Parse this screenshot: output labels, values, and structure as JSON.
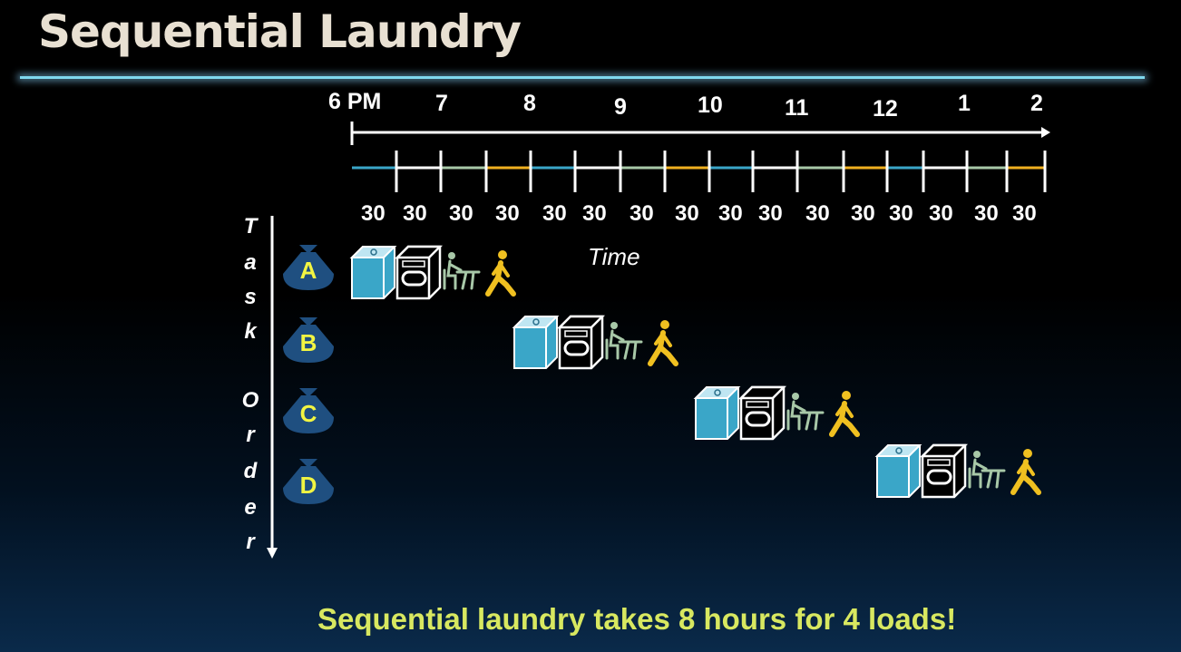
{
  "title": "Sequential Laundry",
  "timeline": {
    "hours": [
      "6 PM",
      "7",
      "8",
      "9",
      "10",
      "11",
      "12",
      "1",
      "2"
    ],
    "halves": [
      "30",
      "30",
      "30",
      "30",
      "30",
      "30",
      "30",
      "30",
      "30",
      "30",
      "30",
      "30",
      "30",
      "30",
      "30",
      "30"
    ],
    "segment_colors": [
      "#3aa6c8",
      "#ffffff",
      "#a8c8a8",
      "#f0b020"
    ]
  },
  "time_label": "Time",
  "task_order_label": [
    "T",
    "a",
    "s",
    "k",
    "O",
    "r",
    "d",
    "e",
    "r"
  ],
  "loads": [
    {
      "label": "A"
    },
    {
      "label": "B"
    },
    {
      "label": "C"
    },
    {
      "label": "D"
    }
  ],
  "footer": "Sequential laundry takes 8 hours for 4 loads!",
  "colors": {
    "washer": "#3aa6c8",
    "dryer": "#000000",
    "folder": "#a8c8a8",
    "walker": "#f0c020",
    "bag": "#1f4f80",
    "bag_letter": "#f2f542"
  }
}
